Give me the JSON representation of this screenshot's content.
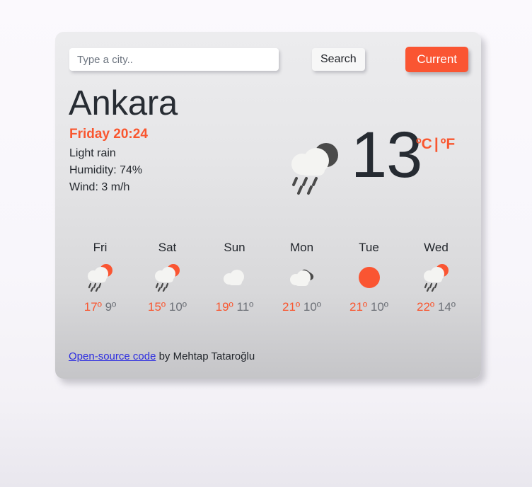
{
  "search": {
    "placeholder": "Type a city..",
    "value": "",
    "search_label": "Search",
    "current_label": "Current"
  },
  "current": {
    "city": "Ankara",
    "date": "Friday 20:24",
    "description": "Light rain",
    "humidity": "Humidity: 74%",
    "wind": "Wind: 3 m/h",
    "temperature": "13",
    "unit_celsius": "ºC",
    "unit_separator": "|",
    "unit_fahrenheit": "ºF",
    "icon": "moon-cloud-rain-icon"
  },
  "forecast": [
    {
      "day": "Fri",
      "icon": "sun-cloud-rain-icon",
      "max": "17º",
      "min": "9º"
    },
    {
      "day": "Sat",
      "icon": "sun-cloud-rain-icon",
      "max": "15º",
      "min": "10º"
    },
    {
      "day": "Sun",
      "icon": "cloud-icon",
      "max": "19º",
      "min": "11º"
    },
    {
      "day": "Mon",
      "icon": "cloud-dark-cloud-icon",
      "max": "21º",
      "min": "10º"
    },
    {
      "day": "Tue",
      "icon": "sun-icon",
      "max": "21º",
      "min": "10º"
    },
    {
      "day": "Wed",
      "icon": "sun-cloud-rain-icon",
      "max": "22º",
      "min": "14º"
    }
  ],
  "footer": {
    "link_label": "Open-source code",
    "credit": " by Mehtap Tataroğlu"
  },
  "colors": {
    "accent": "#fa5532",
    "text": "#22262c",
    "muted": "#6d7178",
    "link": "#2c2ce0",
    "cloud_light": "#f4f4f2",
    "cloud_dark": "#4a4a4a"
  }
}
